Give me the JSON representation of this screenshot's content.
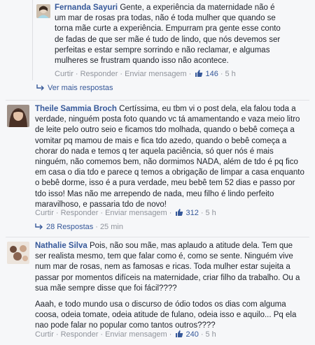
{
  "comments": [
    {
      "author": "Fernanda Sayuri",
      "text": "Gente, a experiência da maternidade não é um mar de rosas pra todas, não é toda mulher que quando se torna mãe curte a experiência. Empurram pra gente esse conto de fadas de que ser mãe é tudo de lindo, que nós devemos ser perfeitas e estar sempre sorrindo e não reclamar, e algumas mulheres se frustram quando isso não acontece.",
      "reply_label": "Curtir",
      "respond_label": "Responder",
      "message_label": "Enviar mensagem",
      "likes": "146",
      "time": "5 h"
    },
    {
      "author": "Theile Sammia Broch",
      "text": "Certíssima, eu tbm vi o post dela, ela falou toda a verdade, ninguém posta foto quando vc tá amamentando e vaza meio litro de leite pelo outro seio e ficamos tdo molhada, quando o bebê começa a vomitar pq mamou de mais e fica tdo azedo, quando o bebê começa a chorar do nada e temos q ter aquela paciência, só quer nós é mais ninguém, não comemos bem, não dormimos NADA, além de tdo é pq fico em casa o dia tdo e parece q temos a obrigação de limpar a casa enquanto o bebê dorme, isso é a pura verdade, meu bebê tem 52 dias e passo por tdo isso! Mas não me arrependo de nada, meu filho é lindo perfeito maravilhoso, e passaria tdo de novo!",
      "reply_label": "Curtir",
      "respond_label": "Responder",
      "message_label": "Enviar mensagem",
      "likes": "312",
      "time": "5 h"
    },
    {
      "author": "Nathalie Silva",
      "text": "Pois, não sou mãe, mas aplaudo a atitude dela. Tem que ser realista mesmo, tem que falar como é, como se sente. Ninguém vive num mar de rosas, nem as famosas e ricas. Toda mulher estar sujeita a passar por momentos difíceis na maternidade, criar filho da trabalho. Ou a sua mãe sempre disse que foi fácil????",
      "text2": "Aaah, e todo mundo usa o discurso de ódio todos os dias com alguma coosa, odeia tomate, odeia atitude de fulano, odeia isso e aquilo... Pq ela nao pode falar no popular como tantos outros????",
      "reply_label": "Curtir",
      "respond_label": "Responder",
      "message_label": "Enviar mensagem",
      "likes": "240",
      "time": "5 h"
    }
  ],
  "more_replies": "Ver mais respostas",
  "replies_summary": {
    "count": "28 Respostas",
    "time": "25 min"
  }
}
